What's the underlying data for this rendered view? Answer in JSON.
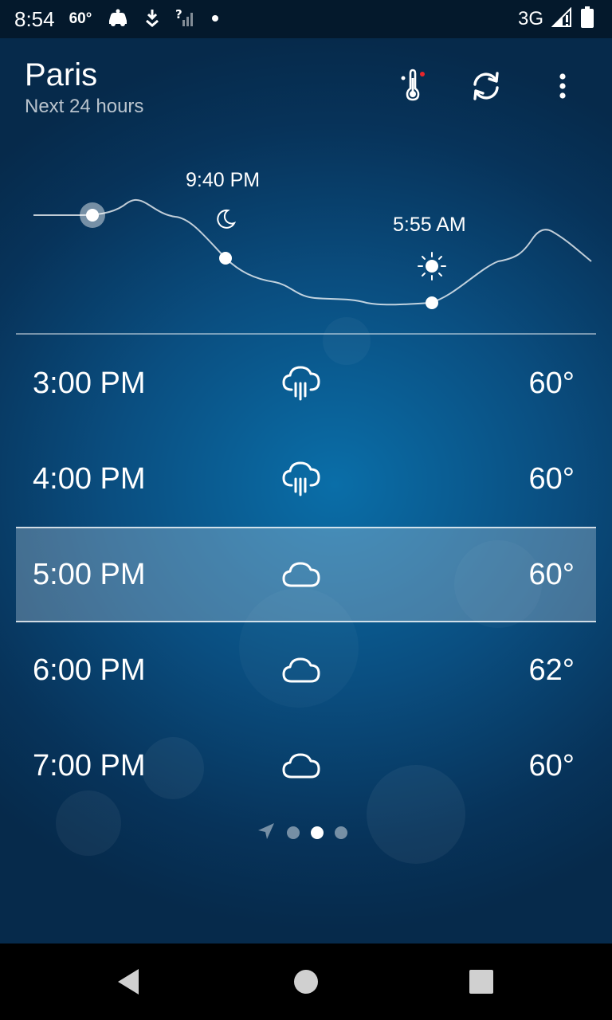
{
  "status_bar": {
    "time": "8:54",
    "temperature": "60°",
    "network": "3G",
    "icons": [
      "car-icon",
      "download-icon",
      "no-sim-signal-icon",
      "dot-icon",
      "cell-signal-icon",
      "battery-icon"
    ]
  },
  "header": {
    "city": "Paris",
    "subtitle": "Next 24 hours",
    "actions": [
      "thermometer-icon",
      "refresh-icon",
      "more-vert-icon"
    ]
  },
  "curve": {
    "sunset_time": "9:40 PM",
    "sunrise_time": "5:55 AM",
    "sunset_icon": "moon-icon",
    "sunrise_icon": "sun-icon"
  },
  "hours": [
    {
      "time": "3:00 PM",
      "icon": "rain-cloud-icon",
      "temp": "60°",
      "selected": false
    },
    {
      "time": "4:00 PM",
      "icon": "rain-cloud-icon",
      "temp": "60°",
      "selected": false
    },
    {
      "time": "5:00 PM",
      "icon": "cloud-icon",
      "temp": "60°",
      "selected": true
    },
    {
      "time": "6:00 PM",
      "icon": "cloud-icon",
      "temp": "62°",
      "selected": false
    },
    {
      "time": "7:00 PM",
      "icon": "cloud-icon",
      "temp": "60°",
      "selected": false
    }
  ],
  "pager": {
    "page_count": 3,
    "active_page": 2,
    "location_icon": "location-arrow-icon"
  },
  "nav_bar": {
    "buttons": [
      "back-icon",
      "home-icon",
      "recents-icon"
    ]
  },
  "colors": {
    "background_center": "#0a6ea8",
    "background_edge": "#062a4b",
    "status_bar": "#04192c",
    "accent_red": "#e8262b"
  }
}
